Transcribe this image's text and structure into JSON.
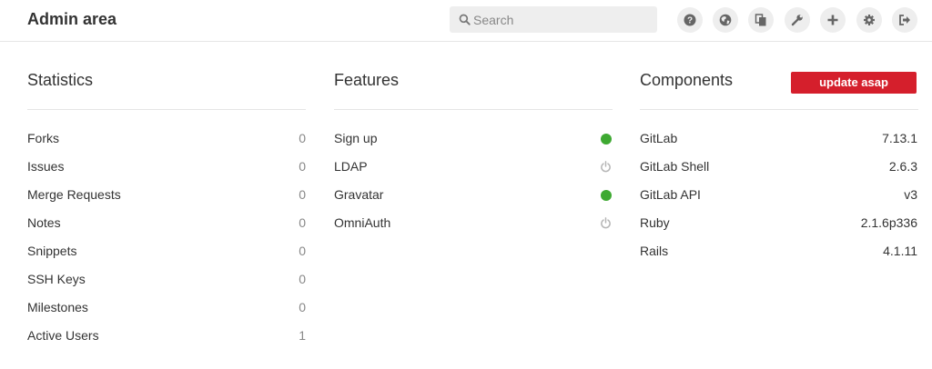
{
  "header": {
    "title": "Admin area",
    "search_placeholder": "Search",
    "icons": [
      "help-icon",
      "globe-icon",
      "copy-icon",
      "wrench-icon",
      "plus-icon",
      "gear-icon",
      "sign-out-icon"
    ]
  },
  "statistics": {
    "title": "Statistics",
    "rows": [
      {
        "label": "Forks",
        "value": "0"
      },
      {
        "label": "Issues",
        "value": "0"
      },
      {
        "label": "Merge Requests",
        "value": "0"
      },
      {
        "label": "Notes",
        "value": "0"
      },
      {
        "label": "Snippets",
        "value": "0"
      },
      {
        "label": "SSH Keys",
        "value": "0"
      },
      {
        "label": "Milestones",
        "value": "0"
      },
      {
        "label": "Active Users",
        "value": "1"
      }
    ]
  },
  "features": {
    "title": "Features",
    "rows": [
      {
        "label": "Sign up",
        "status": "enabled"
      },
      {
        "label": "LDAP",
        "status": "disabled"
      },
      {
        "label": "Gravatar",
        "status": "enabled"
      },
      {
        "label": "OmniAuth",
        "status": "disabled"
      }
    ]
  },
  "components": {
    "title": "Components",
    "badge": "update asap",
    "rows": [
      {
        "label": "GitLab",
        "value": "7.13.1"
      },
      {
        "label": "GitLab Shell",
        "value": "2.6.3"
      },
      {
        "label": "GitLab API",
        "value": "v3"
      },
      {
        "label": "Ruby",
        "value": "2.1.6p336"
      },
      {
        "label": "Rails",
        "value": "4.1.11"
      }
    ]
  },
  "colors": {
    "enabled": "#3ea932",
    "disabled_icon": "#b5b5b5",
    "badge": "#d51f2c",
    "stat_value": "#888888"
  }
}
